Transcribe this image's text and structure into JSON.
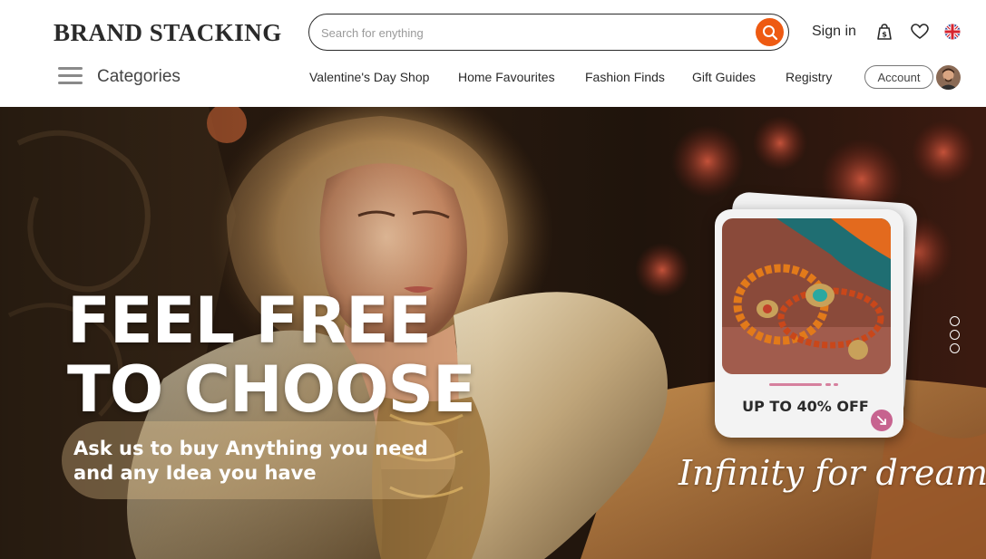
{
  "brand": {
    "name": "BRAND STACKING"
  },
  "search": {
    "placeholder": "Search for enything",
    "value": ""
  },
  "header": {
    "signin_label": "Sign in",
    "icons": [
      "bag-dollar-icon",
      "heart-icon",
      "uk-flag-icon"
    ]
  },
  "subnav": {
    "categories_label": "Categories",
    "links": [
      "Valentine's Day Shop",
      "Home Favourites",
      "Fashion Finds",
      "Gift Guides",
      "Registry"
    ],
    "account_label": "Account"
  },
  "hero": {
    "headline_line1": "FEEL FREE",
    "headline_line2": "TO CHOOSE",
    "subtext_line1": "Ask us to buy Anything you need",
    "subtext_line2": "and any Idea you have",
    "tagline": "Infinity for dreams",
    "promo_card": {
      "label": "UP TO 40% OFF"
    },
    "slide_count": 3
  },
  "colors": {
    "accent": "#ee5a12",
    "promo_pink": "#c7638f",
    "text_dark": "#2a2a2a"
  }
}
